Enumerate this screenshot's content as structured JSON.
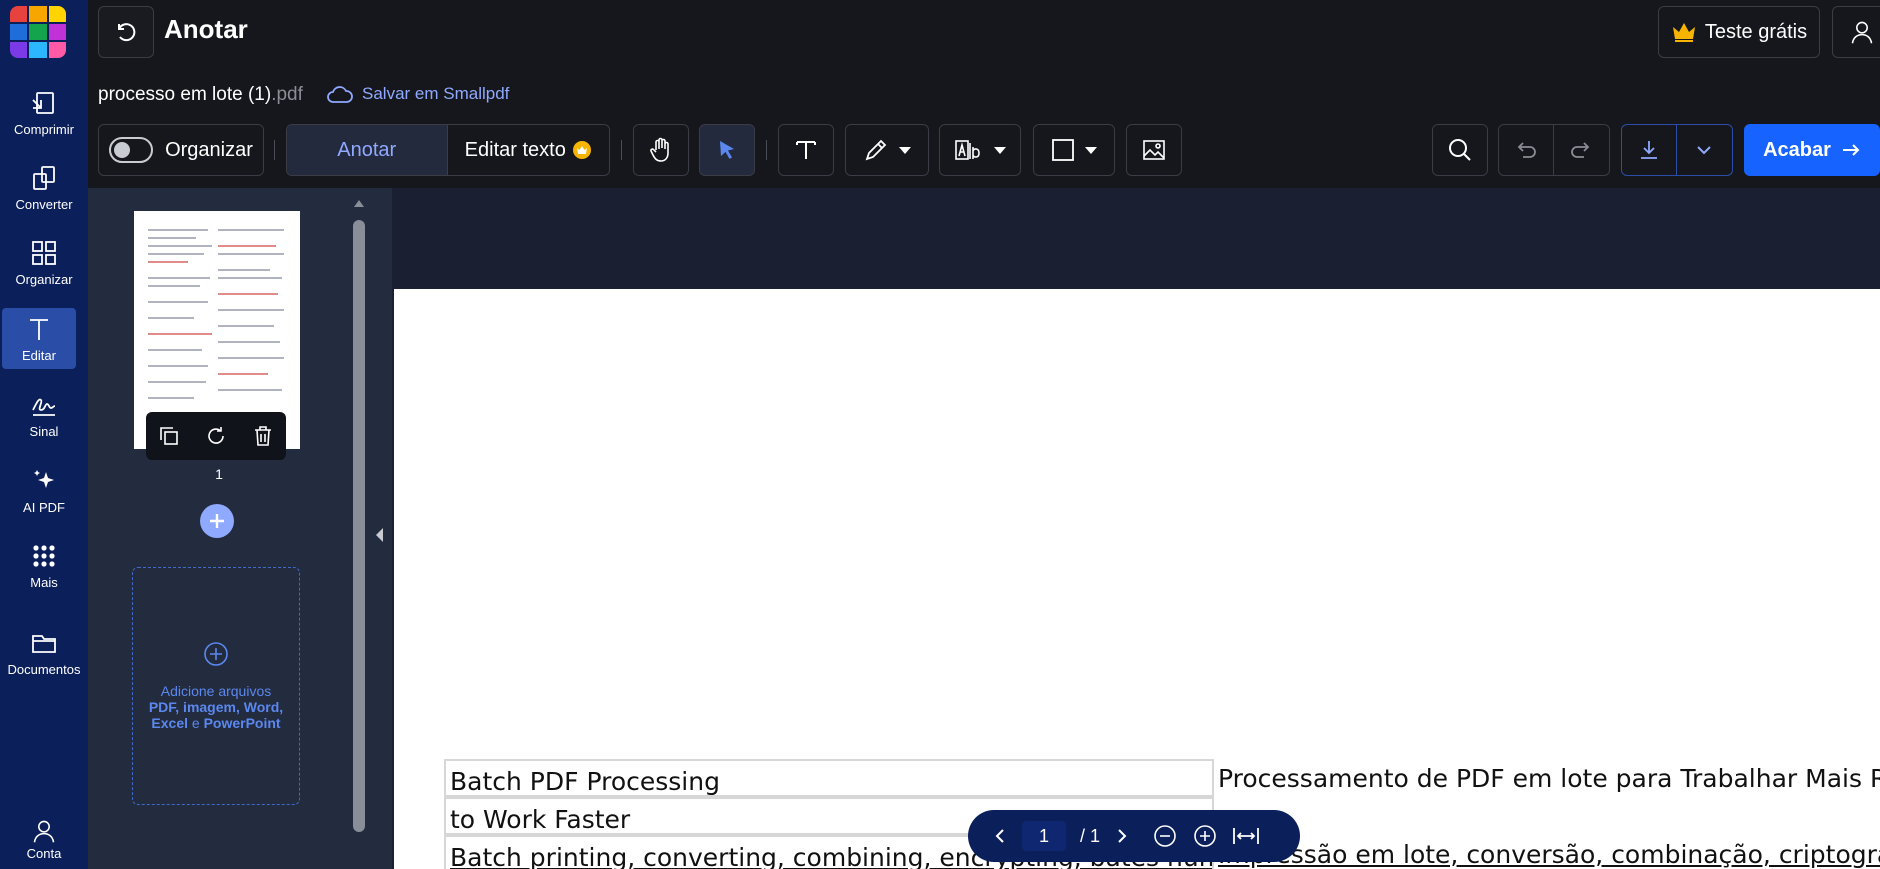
{
  "header": {
    "title": "Anotar",
    "trial_label": "Teste grátis"
  },
  "file": {
    "name": "processo em lote (1)",
    "ext": ".pdf",
    "save_label": "Salvar em Smallpdf"
  },
  "sidebar": {
    "items": [
      {
        "label": "Comprimir",
        "icon": "compress-icon"
      },
      {
        "label": "Converter",
        "icon": "convert-icon"
      },
      {
        "label": "Organizar",
        "icon": "grid-icon"
      },
      {
        "label": "Editar",
        "icon": "text-icon",
        "active": true
      },
      {
        "label": "Sinal",
        "icon": "signature-icon"
      },
      {
        "label": "AI PDF",
        "icon": "sparkle-icon"
      },
      {
        "label": "Mais",
        "icon": "apps-icon"
      },
      {
        "label": "Documentos",
        "icon": "folder-icon"
      },
      {
        "label": "Conta",
        "icon": "user-icon"
      }
    ]
  },
  "toolbar": {
    "organize_label": "Organizar",
    "annotate_label": "Anotar",
    "edit_text_label": "Editar texto",
    "finish_label": "Acabar"
  },
  "thumbnails": {
    "page_number": "1",
    "add_files_line1": "Adicione arquivos",
    "add_files_line2": "PDF, imagem, Word,",
    "add_files_line3a": "Excel",
    "add_files_line3b": " e ",
    "add_files_line3c": "PowerPoint"
  },
  "document": {
    "row1_left": "Batch PDF Processing",
    "row1_right": "Processamento de PDF em lote para Trabalhar Mais Rápido",
    "row2_left": "to Work Faster",
    "row3_left": "Batch printing, converting, combining, encrypting, bates numbering",
    "row3_right": "Impressão em lote, conversão, combinação, criptografia"
  },
  "pagination": {
    "current": "1",
    "total": "/ 1"
  },
  "colors": {
    "accent": "#1763ff",
    "nav_bg": "#0b1f5b",
    "link": "#8fa9ff"
  }
}
